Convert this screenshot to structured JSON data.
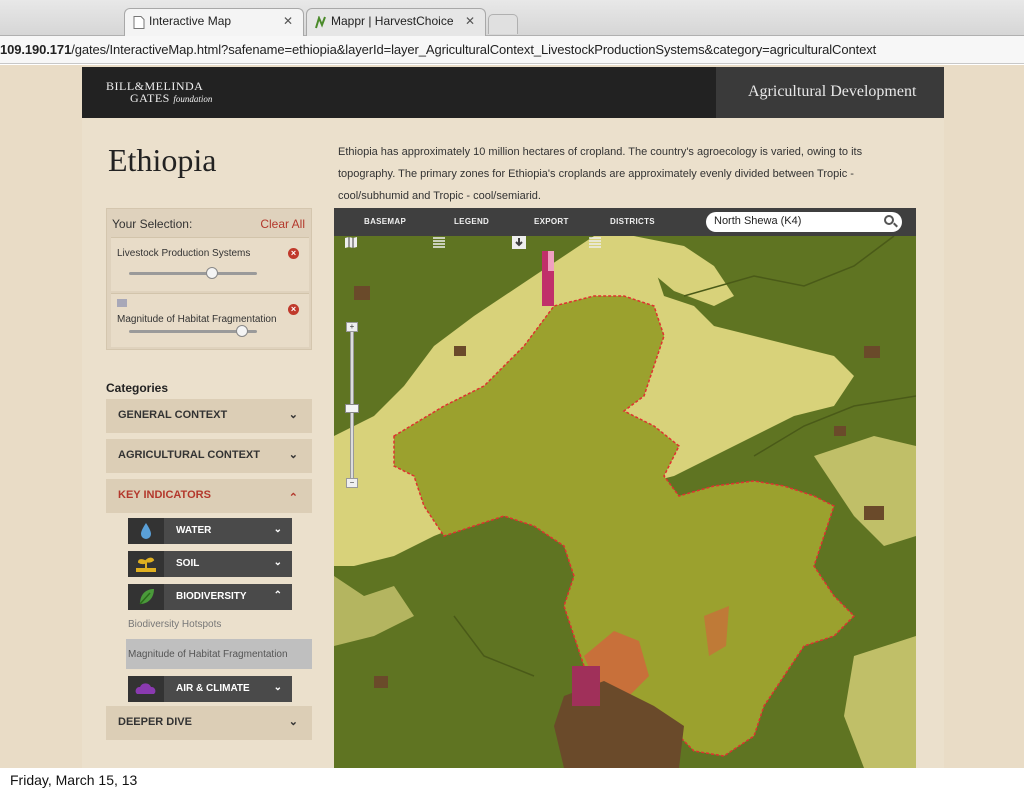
{
  "browser": {
    "tabs": [
      {
        "label": "Interactive Map",
        "active": true
      },
      {
        "label": "Mappr | HarvestChoice",
        "active": false
      }
    ],
    "url_host": "109.190.171",
    "url_rest": "/gates/InteractiveMap.html?safename=ethiopia&layerId=layer_AgriculturalContext_LivestockProductionSystems&category=agriculturalContext"
  },
  "header": {
    "logo_line1": "BILL&MELINDA",
    "logo_line2": "GATES",
    "logo_foundation": "foundation",
    "section_title": "Agricultural Development"
  },
  "page": {
    "country": "Ethiopia",
    "description": "Ethiopia has approximately 10 million hectares of cropland. The country's agroecology is varied, owing to its topography. The primary zones for Ethiopia's croplands are approximately evenly divided between Tropic - cool/subhumid and Tropic - cool/semiarid."
  },
  "selection": {
    "heading": "Your Selection:",
    "clear_label": "Clear All",
    "items": [
      {
        "label": "Livestock Production Systems",
        "slider_value": 0.65
      },
      {
        "label": "Magnitude of Habitat Fragmentation",
        "slider_value": 0.88
      }
    ]
  },
  "categories": {
    "title": "Categories",
    "items": [
      {
        "label": "GENERAL CONTEXT",
        "expanded": false
      },
      {
        "label": "AGRICULTURAL CONTEXT",
        "expanded": false
      },
      {
        "label": "KEY INDICATORS",
        "expanded": true
      },
      {
        "label": "DEEPER DIVE",
        "expanded": false
      }
    ],
    "key_indicators": [
      {
        "label": "WATER",
        "icon": "water-drop-icon",
        "icon_color": "#5aa0d8"
      },
      {
        "label": "SOIL",
        "icon": "soil-sprout-icon",
        "icon_color": "#e0b020"
      },
      {
        "label": "BIODIVERSITY",
        "icon": "leaf-icon",
        "icon_color": "#4a9a3a"
      },
      {
        "label": "AIR & CLIMATE",
        "icon": "cloud-icon",
        "icon_color": "#8a3ab0"
      }
    ],
    "biodiversity_layers": [
      {
        "label": "Biodiversity Hotspots",
        "active": false
      },
      {
        "label": "Magnitude of Habitat Fragmentation",
        "active": true
      }
    ]
  },
  "map": {
    "toolbar": {
      "basemap": "BASEMAP",
      "legend": "LEGEND",
      "export": "EXPORT",
      "districts": "DISTRICTS"
    },
    "search_value": "North Shewa (K4)",
    "colors": {
      "base": "#5f7422",
      "region": "#9ba12e",
      "region_border": "#e03030",
      "light": "#d8d27a",
      "dark_patch": "#6a4a2a",
      "orange_patch": "#c8703a",
      "pink_patch": "#c0306a"
    }
  },
  "caption": "Friday, March 15, 13"
}
